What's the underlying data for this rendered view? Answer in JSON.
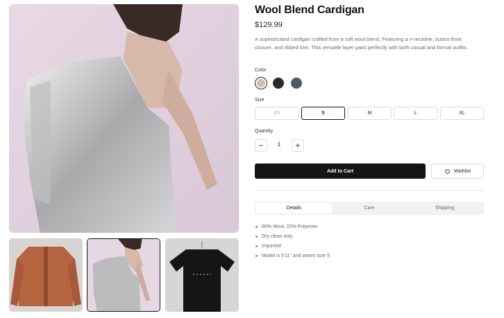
{
  "product": {
    "title": "Wool Blend Cardigan",
    "price": "$129.99",
    "description": "A sophisticated cardigan crafted from a soft wool blend. Featuring a v-neckline, button-front closure, and ribbed trim. This versatile layer pairs perfectly with both casual and formal outfits."
  },
  "gallery": {
    "selected_thumbnail": 2,
    "thumbnails": [
      "brown-bomber-jacket",
      "silver-sequin-dress",
      "black-t-shirt"
    ]
  },
  "color": {
    "label": "Color",
    "options": [
      {
        "name": "beige",
        "hex": "#cdbfae",
        "selected": true
      },
      {
        "name": "black",
        "hex": "#2a2a2a",
        "selected": false
      },
      {
        "name": "slate",
        "hex": "#4b5c66",
        "selected": false
      }
    ]
  },
  "size": {
    "label": "Size",
    "options": [
      "XS",
      "S",
      "M",
      "L",
      "XL"
    ],
    "selected": "S",
    "disabled": [
      "XS"
    ]
  },
  "quantity": {
    "label": "Quantity",
    "value": "1",
    "minus": "−",
    "plus": "+"
  },
  "actions": {
    "add_to_cart": "Add to Cart",
    "wishlist": "Wishlist"
  },
  "tabs": {
    "items": [
      "Details",
      "Care",
      "Shipping"
    ],
    "active": "Details"
  },
  "details": [
    "80% Wool, 20% Polyester",
    "Dry clean only",
    "Imported",
    "Model is 5'11\" and wears size S"
  ],
  "colors": {
    "primary_button": "#141414",
    "background": "#ffffff"
  }
}
